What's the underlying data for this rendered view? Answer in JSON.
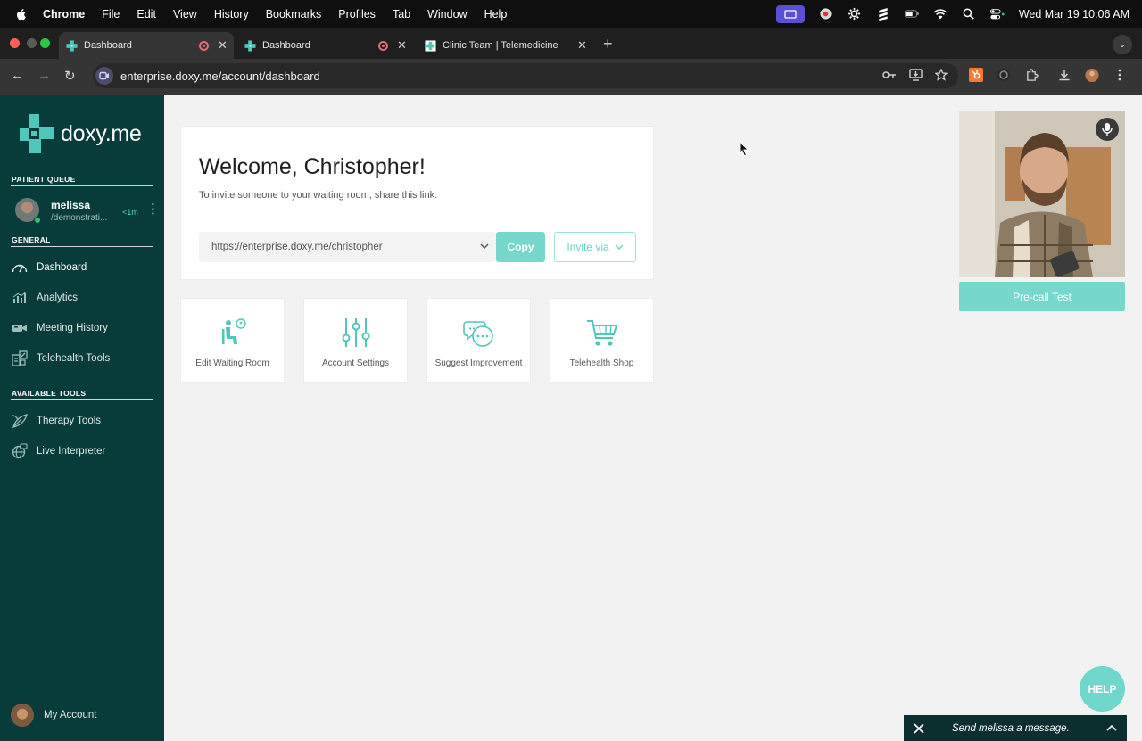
{
  "menubar": {
    "app": "Chrome",
    "items": [
      "File",
      "Edit",
      "View",
      "History",
      "Bookmarks",
      "Profiles",
      "Tab",
      "Window",
      "Help"
    ],
    "clock": "Wed Mar 19  10:06 AM",
    "tray_icons": [
      "screen-share-icon",
      "record-icon",
      "gear-icon",
      "stack-icon",
      "battery-icon",
      "wifi-icon",
      "spotlight-icon",
      "control-center-icon"
    ]
  },
  "tabs": [
    {
      "title": "Dashboard",
      "active": true
    },
    {
      "title": "Dashboard",
      "active": false
    },
    {
      "title": "Clinic Team | Telemedicine",
      "active": false
    }
  ],
  "address_bar": {
    "url": "enterprise.doxy.me/account/dashboard"
  },
  "sidebar": {
    "logo_text": "doxy.me",
    "patient_queue_label": "PATIENT QUEUE",
    "queue": [
      {
        "name": "melissa",
        "room": "/demonstrati...",
        "wait": "<1m"
      }
    ],
    "general_label": "GENERAL",
    "general_items": [
      {
        "label": "Dashboard",
        "icon": "speedometer-icon"
      },
      {
        "label": "Analytics",
        "icon": "chart-icon"
      },
      {
        "label": "Meeting History",
        "icon": "camera-icon"
      },
      {
        "label": "Telehealth Tools",
        "icon": "tools-icon"
      }
    ],
    "tools_label": "AVAILABLE TOOLS",
    "tools_items": [
      {
        "label": "Therapy Tools",
        "icon": "leaf-icon"
      },
      {
        "label": "Live Interpreter",
        "icon": "globe-icon"
      }
    ],
    "account_label": "My Account"
  },
  "welcome": {
    "title": "Welcome, Christopher!",
    "subtitle": "To invite someone to your waiting room, share this link:",
    "link": "https://enterprise.doxy.me/christopher",
    "copy_label": "Copy",
    "invite_label": "Invite via"
  },
  "tiles": [
    {
      "label": "Edit Waiting Room",
      "icon": "waiting-room-icon"
    },
    {
      "label": "Account Settings",
      "icon": "sliders-icon"
    },
    {
      "label": "Suggest Improvement",
      "icon": "chat-bubbles-icon"
    },
    {
      "label": "Telehealth Shop",
      "icon": "cart-icon"
    }
  ],
  "video": {
    "precall_label": "Pre-call Test"
  },
  "help": {
    "label": "HELP"
  },
  "chat": {
    "placeholder": "Send melissa a message."
  },
  "colors": {
    "sidebar": "#073c3a",
    "accent": "#76d8cd",
    "page": "#f2f2f2"
  }
}
